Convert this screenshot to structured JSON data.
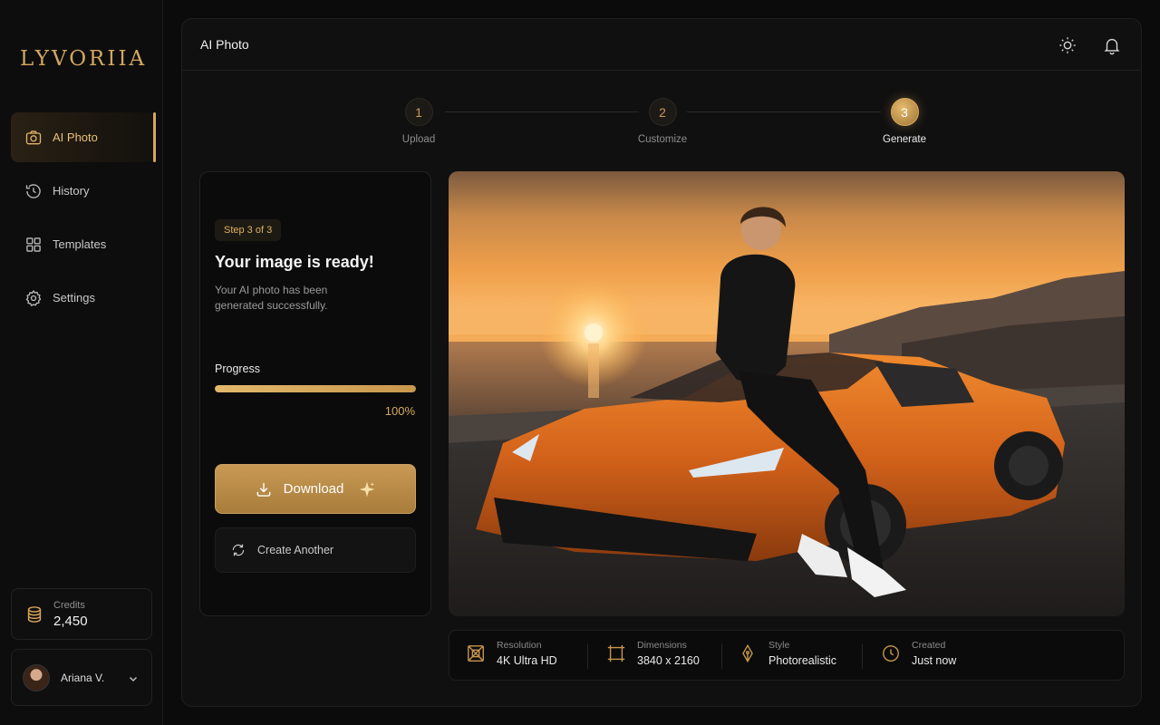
{
  "app": {
    "brand": "LYVORIIA"
  },
  "sidebar": {
    "items": [
      {
        "label": "AI Photo",
        "icon": "camera-icon",
        "active": true
      },
      {
        "label": "History",
        "icon": "history-icon",
        "active": false
      },
      {
        "label": "Templates",
        "icon": "grid-icon",
        "active": false
      },
      {
        "label": "Settings",
        "icon": "gear-icon",
        "active": false
      }
    ],
    "credits": {
      "label": "Credits",
      "value": "2,450"
    },
    "user": {
      "name": "Ariana V."
    }
  },
  "header": {
    "title": "AI Photo"
  },
  "stepper": {
    "steps": [
      {
        "number": "1",
        "label": "Upload"
      },
      {
        "number": "2",
        "label": "Customize"
      },
      {
        "number": "3",
        "label": "Generate"
      }
    ],
    "current": 3
  },
  "result": {
    "badge": "Step 3 of 3",
    "heading": "Your image is ready!",
    "subtitle": "Your AI photo has been generated successfully.",
    "progress_label": "Progress",
    "progress_value": 1.0,
    "progress_text": "100%",
    "download_label": "Download",
    "create_another_label": "Create Another"
  },
  "info": [
    {
      "key": "Resolution",
      "value": "4K Ultra HD",
      "icon": "resolution-icon"
    },
    {
      "key": "Dimensions",
      "value": "3840 x 2160",
      "icon": "crop-icon"
    },
    {
      "key": "Style",
      "value": "Photorealistic",
      "icon": "pen-nib-icon"
    },
    {
      "key": "Created",
      "value": "Just now",
      "icon": "clock-icon"
    }
  ],
  "colors": {
    "accent": "#d8a659",
    "background": "#0b0b0b",
    "panel": "#101010"
  }
}
